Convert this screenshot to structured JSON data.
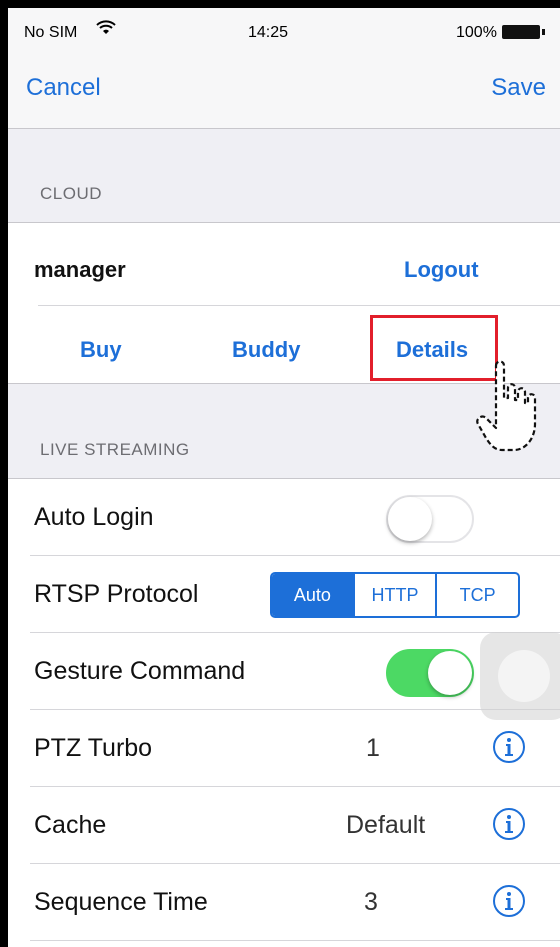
{
  "status_bar": {
    "carrier": "No SIM",
    "wifi_icon": "wifi-icon",
    "time": "14:25",
    "battery": "100%",
    "battery_icon": "battery-icon"
  },
  "nav": {
    "cancel": "Cancel",
    "save": "Save"
  },
  "cloud": {
    "header": "CLOUD",
    "user": "manager",
    "logout": "Logout",
    "buttons": [
      "Buy",
      "Buddy",
      "Details"
    ],
    "highlight_color": "#e21f2b"
  },
  "live_streaming": {
    "header": "LIVE STREAMING",
    "auto_login": {
      "label": "Auto Login",
      "on": false
    },
    "rtsp": {
      "label": "RTSP Protocol",
      "options": [
        "Auto",
        "HTTP",
        "TCP"
      ],
      "selected": "Auto"
    },
    "gesture": {
      "label": "Gesture Command",
      "on": true
    },
    "ptz_turbo": {
      "label": "PTZ Turbo",
      "value": "1"
    },
    "cache": {
      "label": "Cache",
      "value": "Default"
    },
    "sequence_time": {
      "label": "Sequence Time",
      "value": "3"
    }
  },
  "colors": {
    "accent": "#1d6fd8",
    "toggle_on": "#4cd964"
  }
}
